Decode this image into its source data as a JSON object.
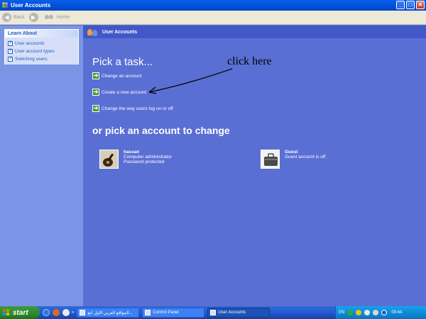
{
  "window": {
    "title": "User Accounts",
    "controls": {
      "minimize": "_",
      "maximize": "□",
      "close": "✕"
    }
  },
  "toolbar": {
    "back_label": "Back",
    "forward_label": "",
    "home_label": "Home"
  },
  "sidebar": {
    "learn_about_title": "Learn About",
    "items": [
      {
        "label": "User accounts",
        "icon": "help-icon"
      },
      {
        "label": "User account types",
        "icon": "help-icon"
      },
      {
        "label": "Switching users",
        "icon": "help-icon"
      }
    ]
  },
  "main": {
    "header_title": "User Accounts",
    "pick_task_title": "Pick a task...",
    "tasks": [
      {
        "label": "Change an account"
      },
      {
        "label": "Create a new account"
      },
      {
        "label": "Change the way users log on or off"
      }
    ],
    "pick_account_title": "or pick an account to change",
    "accounts": [
      {
        "name": "hassan",
        "line1": "Computer administrator",
        "line2": "Password protected",
        "avatar": "guitar-icon"
      },
      {
        "name": "Guest",
        "line1": "Guest account is off",
        "line2": "",
        "avatar": "briefcase-icon"
      }
    ],
    "annotation": "click here"
  },
  "taskbar": {
    "start_label": "start",
    "chevron": "»",
    "buttons": [
      {
        "label": "المواقع العربي الاول لتع...",
        "active": false
      },
      {
        "label": "Control Panel",
        "active": false
      },
      {
        "label": "User Accounts",
        "active": true
      }
    ],
    "tray": {
      "language": "EN",
      "time": "09:44"
    }
  },
  "colors": {
    "titlebar": "#0050DA",
    "main_bg": "#5A6FD4",
    "left_bg": "#7A95E6",
    "task_arrow": "#3C9A2C",
    "start_green": "#3C9A3C"
  }
}
